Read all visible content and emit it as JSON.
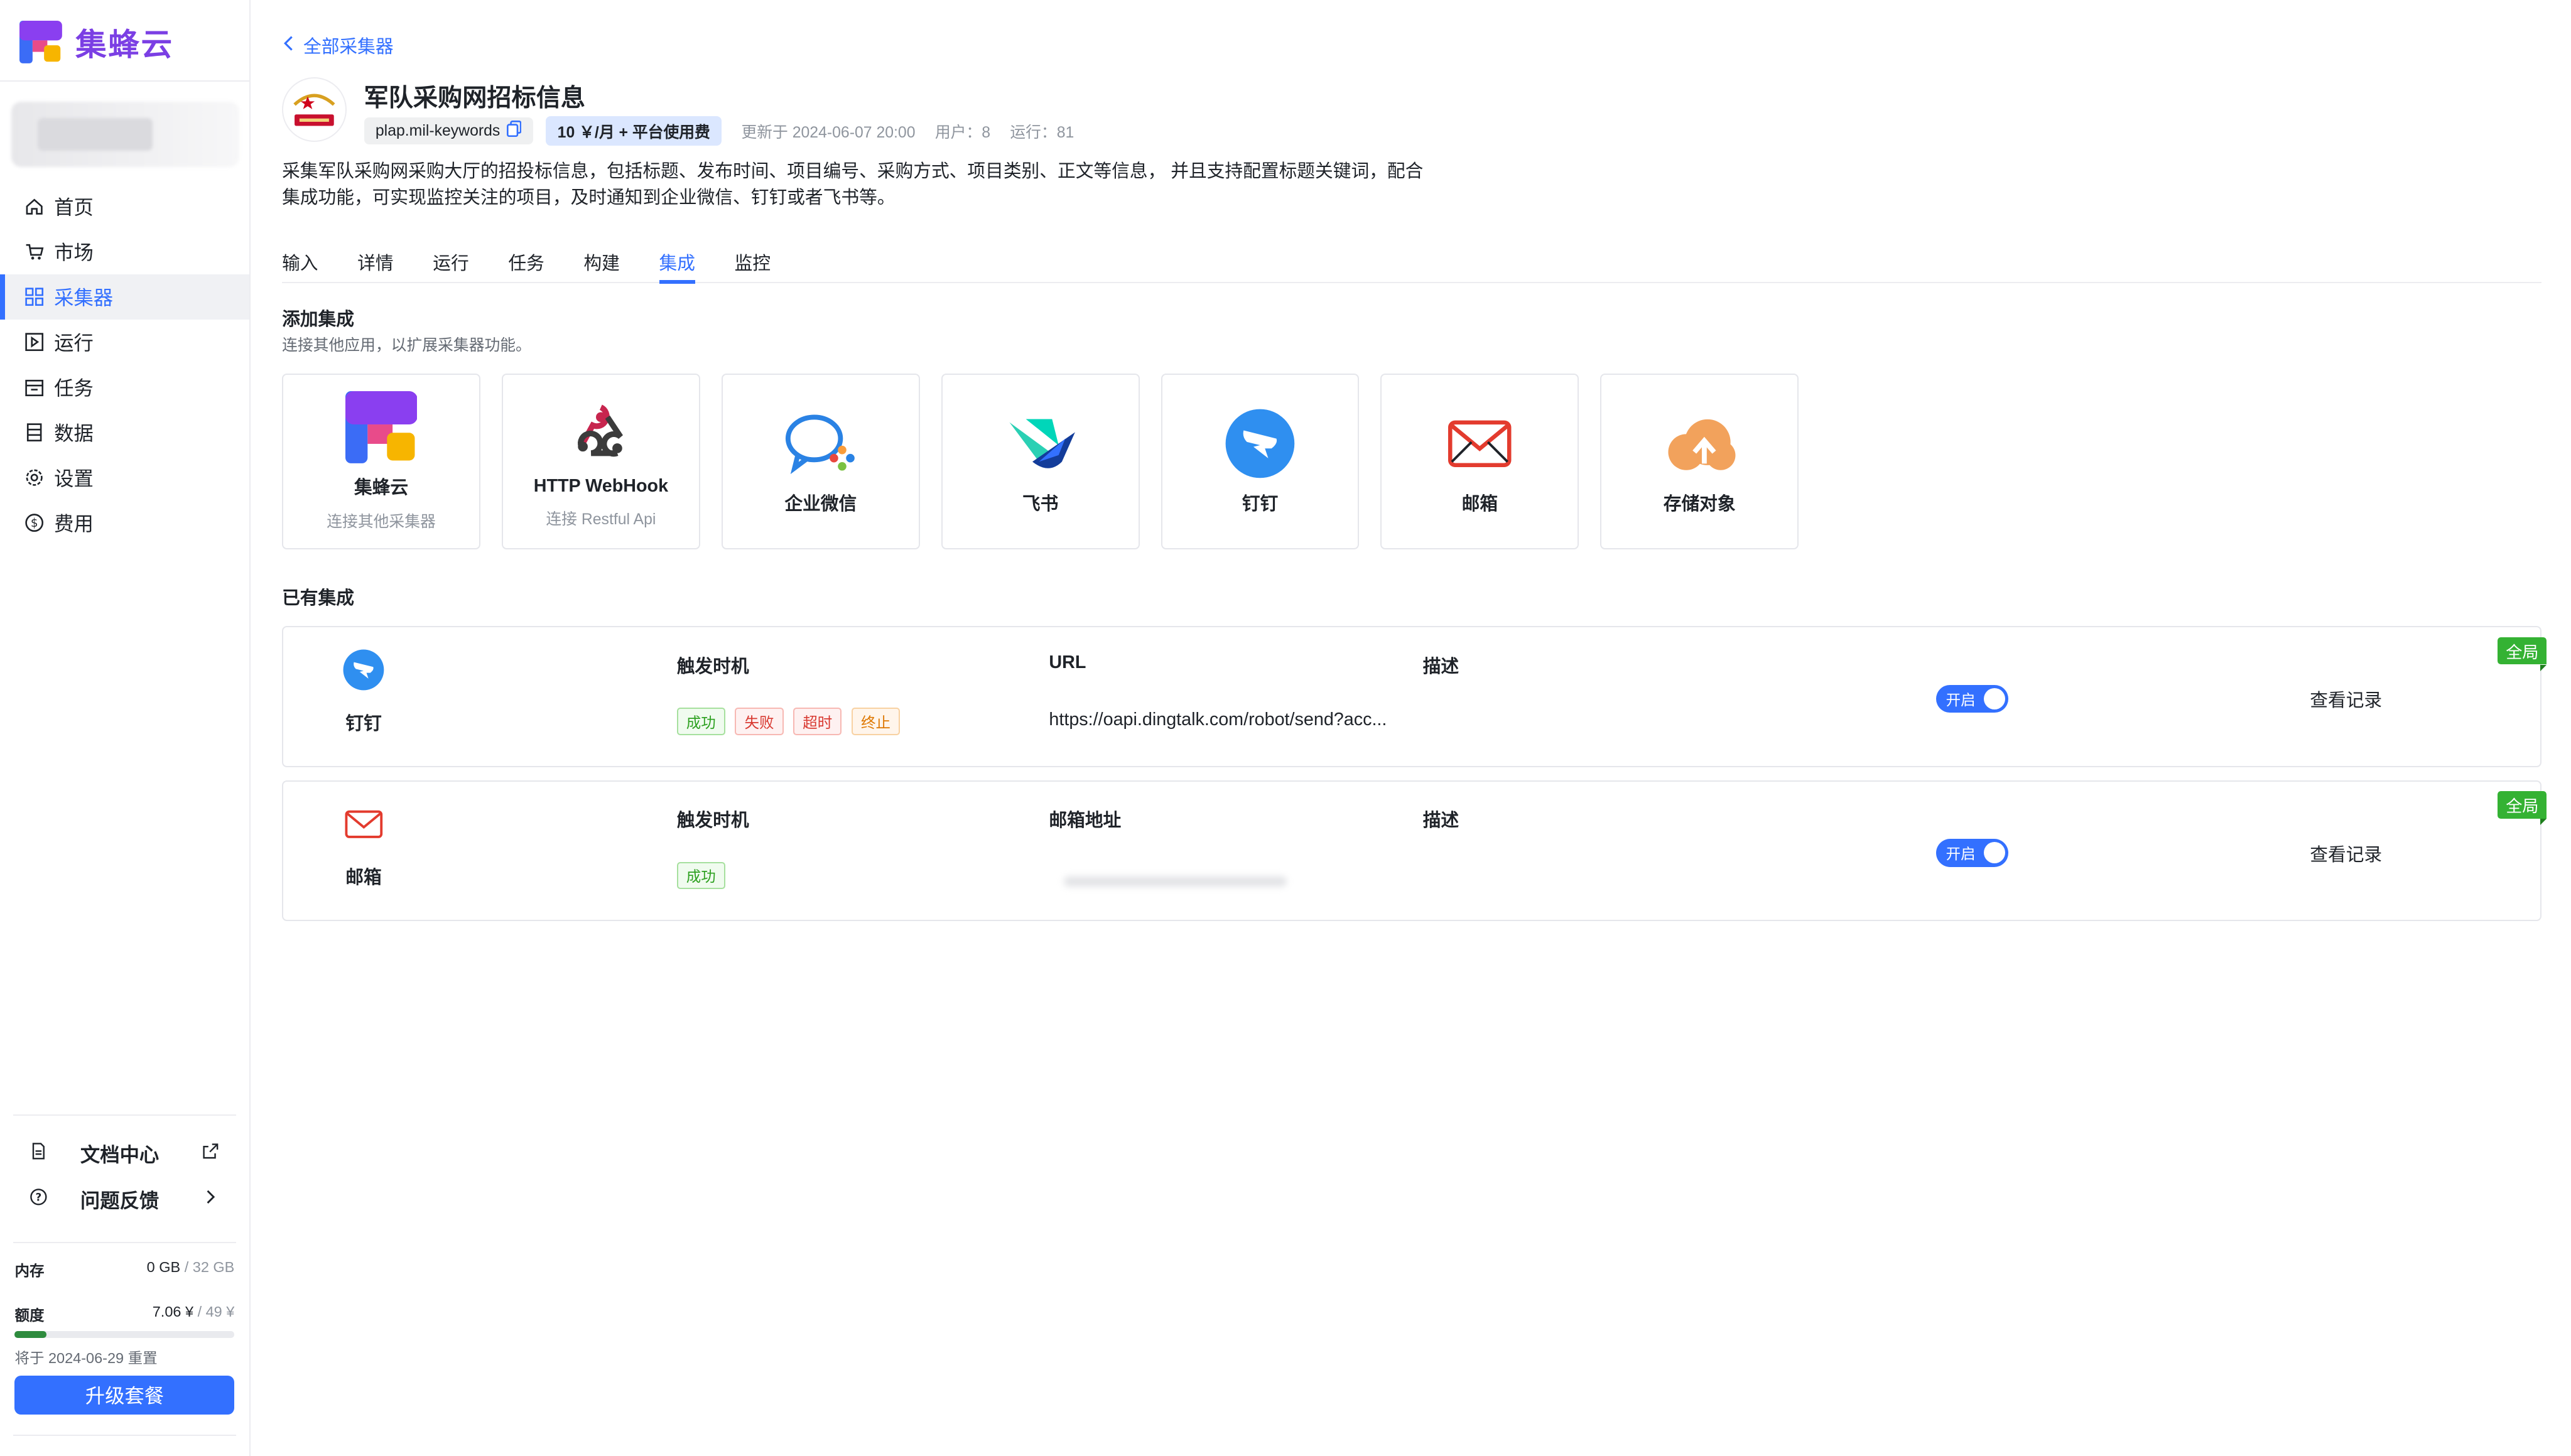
{
  "brand": {
    "name": "集蜂云"
  },
  "sidebar": {
    "items": [
      {
        "label": "首页",
        "icon": "home-icon"
      },
      {
        "label": "市场",
        "icon": "cart-icon"
      },
      {
        "label": "采集器",
        "icon": "grid-icon",
        "active": true
      },
      {
        "label": "运行",
        "icon": "play-box-icon"
      },
      {
        "label": "任务",
        "icon": "calendar-icon"
      },
      {
        "label": "数据",
        "icon": "database-icon"
      },
      {
        "label": "设置",
        "icon": "gear-icon"
      },
      {
        "label": "费用",
        "icon": "dollar-icon"
      }
    ],
    "docs_label": "文档中心",
    "feedback_label": "问题反馈",
    "memory_label": "内存",
    "memory_used": "0 GB",
    "memory_total": " / 32 GB",
    "quota_label": "额度",
    "quota_used": "7.06 ¥",
    "quota_total": " / 49 ¥",
    "quota_fraction": 0.144,
    "reset_note": "将于 2024-06-29 重置",
    "upgrade_label": "升级套餐"
  },
  "header": {
    "back_label": "全部采集器",
    "title": "军队采购网招标信息",
    "slug": "plap.mil-keywords",
    "price": "10 ￥/月 + 平台使用费",
    "updated": "更新于 2024-06-07 20:00",
    "users": "用户：8",
    "runs": "运行：81",
    "description": "采集军队采购网采购大厅的招投标信息，包括标题、发布时间、项目编号、采购方式、项目类别、正文等信息， 并且支持配置标题关键词，配合集成功能，可实现监控关注的项目，及时通知到企业微信、钉钉或者飞书等。"
  },
  "tabs": [
    "输入",
    "详情",
    "运行",
    "任务",
    "构建",
    "集成",
    "监控"
  ],
  "active_tab": "集成",
  "add_integration": {
    "title": "添加集成",
    "subtitle": "连接其他应用，以扩展采集器功能。",
    "cards": [
      {
        "name": "集蜂云",
        "sub": "连接其他采集器",
        "icon": "jifengyun-logo-icon"
      },
      {
        "name": "HTTP WebHook",
        "sub": "连接 Restful Api",
        "icon": "webhook-icon"
      },
      {
        "name": "企业微信",
        "sub": "",
        "icon": "wecom-icon"
      },
      {
        "name": "飞书",
        "sub": "",
        "icon": "feishu-icon"
      },
      {
        "name": "钉钉",
        "sub": "",
        "icon": "dingtalk-icon"
      },
      {
        "name": "邮箱",
        "sub": "",
        "icon": "mail-icon"
      },
      {
        "name": "存储对象",
        "sub": "",
        "icon": "cloud-upload-icon"
      }
    ]
  },
  "existing": {
    "title": "已有集成",
    "rows": [
      {
        "name": "钉钉",
        "col1": "触发时机",
        "col2": "URL",
        "col3": "描述",
        "badges": [
          "成功",
          "失败",
          "超时",
          "终止"
        ],
        "url": "https://oapi.dingtalk.com/robot/send?acc...",
        "toggle": "开启",
        "record": "查看记录",
        "scope": "全局"
      },
      {
        "name": "邮箱",
        "col1": "触发时机",
        "col2": "邮箱地址",
        "col3": "描述",
        "badges": [
          "成功"
        ],
        "toggle": "开启",
        "record": "查看记录",
        "scope": "全局"
      }
    ]
  },
  "colors": {
    "accent": "#3370ff",
    "brand": "#7b3fe4",
    "success": "#34b233"
  }
}
